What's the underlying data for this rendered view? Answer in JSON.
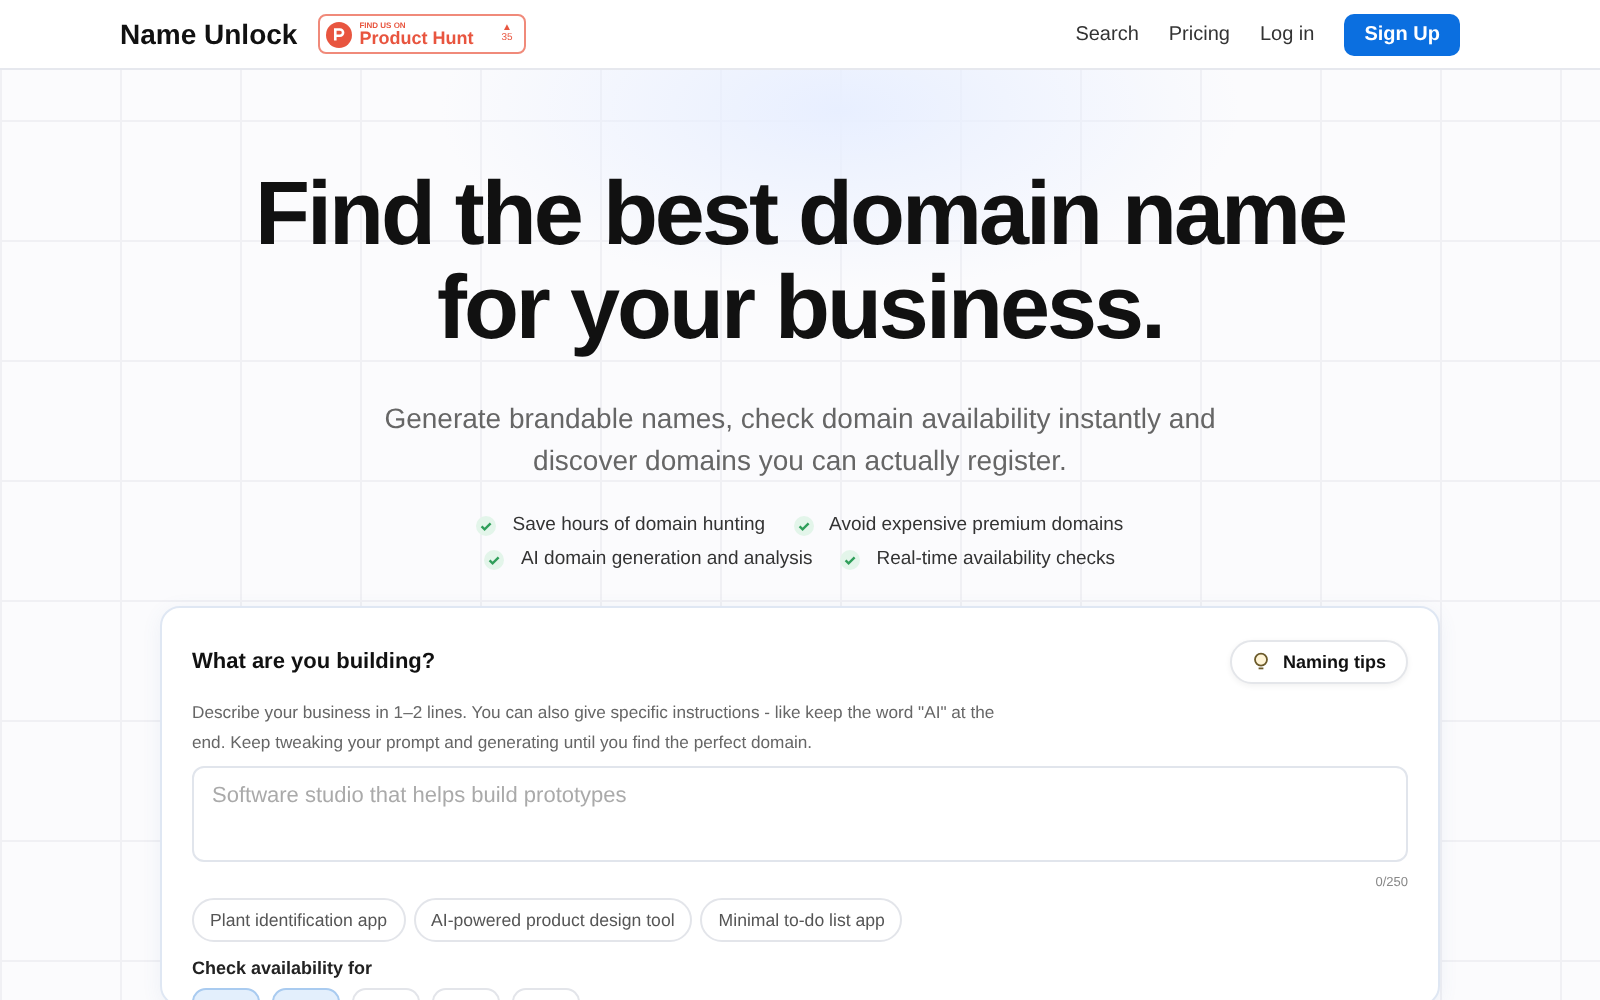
{
  "header": {
    "logo": "Name Unlock",
    "badge": {
      "eyebrow": "FIND US ON",
      "name": "Product Hunt",
      "arrow": "▲",
      "count": "35"
    },
    "nav": [
      {
        "label": "Search",
        "kind": "link"
      },
      {
        "label": "Pricing",
        "kind": "link"
      },
      {
        "label": "Log in",
        "kind": "link"
      },
      {
        "label": "Sign Up",
        "kind": "button"
      }
    ]
  },
  "hero": {
    "title": "Find the best domain name for your business.",
    "subtitle": "Generate brandable names, check domain availability instantly and discover domains you can actually register.",
    "features": [
      [
        "Save hours of domain hunting",
        "Avoid expensive premium domains"
      ],
      [
        "AI domain generation and analysis",
        "Real-time availability checks"
      ]
    ]
  },
  "card": {
    "heading": "What are you building?",
    "tips_button": "Naming tips",
    "description": "Describe your business in 1–2 lines. You can also give specific instructions - like keep the word \"AI\" at the end. Keep tweaking your prompt and generating until you find the perfect domain.",
    "input": {
      "placeholder": "Software studio that helps build prototypes"
    },
    "counter": "0/250",
    "examples": [
      "Plant identification app",
      "AI-powered product design tool",
      "Minimal to-do list app"
    ],
    "availability_label": "Check availability for",
    "tld_options": [
      {
        "selected": true
      },
      {
        "selected": true
      },
      {
        "selected": false
      },
      {
        "selected": false
      },
      {
        "selected": false
      }
    ]
  }
}
